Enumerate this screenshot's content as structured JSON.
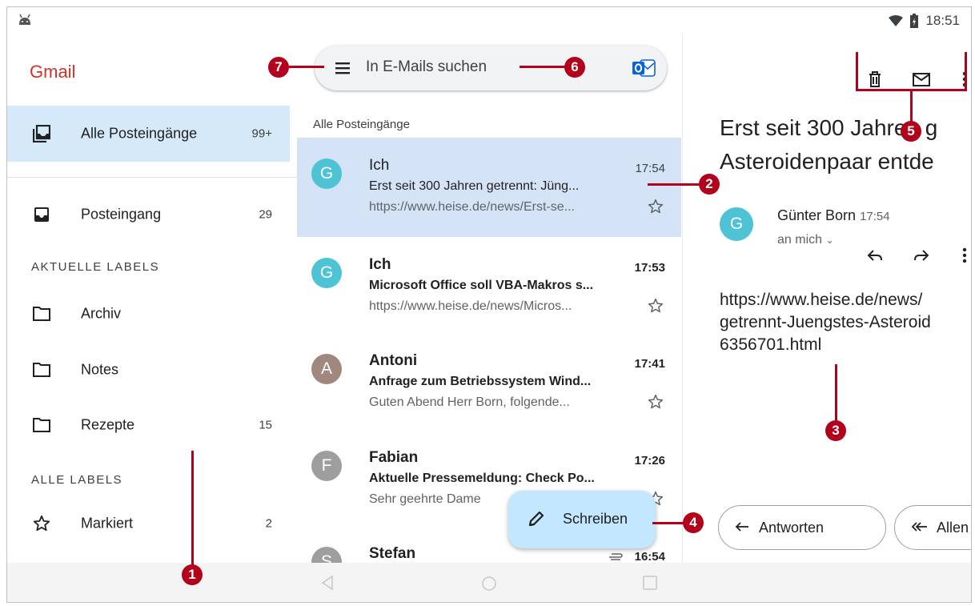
{
  "statusbar": {
    "time": "18:51"
  },
  "sidebar": {
    "app_name": "Gmail",
    "items": [
      {
        "label": "Alle Posteingänge",
        "count": "99+"
      },
      {
        "label": "Posteingang",
        "count": "29"
      },
      {
        "label": "Archiv",
        "count": ""
      },
      {
        "label": "Notes",
        "count": ""
      },
      {
        "label": "Rezepte",
        "count": "15"
      },
      {
        "label": "Markiert",
        "count": "2"
      }
    ],
    "section_recent": "AKTUELLE LABELS",
    "section_all": "ALLE LABELS"
  },
  "search": {
    "placeholder": "In E-Mails suchen"
  },
  "list": {
    "header": "Alle Posteingänge",
    "mails": [
      {
        "initial": "G",
        "color": "#4ec3d6",
        "sender": "Ich",
        "time": "17:54",
        "subject": "Erst seit 300 Jahren getrennt: Jüng...",
        "snippet": "https://www.heise.de/news/Erst-se..."
      },
      {
        "initial": "G",
        "color": "#4ec3d6",
        "sender": "Ich",
        "time": "17:53",
        "subject": "Microsoft Office soll VBA-Makros s...",
        "snippet": "https://www.heise.de/news/Micros..."
      },
      {
        "initial": "A",
        "color": "#a1887f",
        "sender": "Antoni",
        "time": "17:41",
        "subject": "Anfrage zum Betriebssystem Wind...",
        "snippet": "Guten Abend Herr Born, folgende..."
      },
      {
        "initial": "F",
        "color": "#9e9e9e",
        "sender": "Fabian",
        "time": "17:26",
        "subject": "Aktuelle Pressemeldung: Check Po...",
        "snippet": "Sehr geehrte Dame"
      },
      {
        "initial": "S",
        "color": "#9e9e9e",
        "sender": "Stefan",
        "time": "16:54",
        "subject": "",
        "snippet": ""
      }
    ]
  },
  "compose": {
    "label": "Schreiben"
  },
  "reader": {
    "title_line1": "Erst seit 300 Jahren g",
    "title_line2": "Asteroidenpaar entde",
    "from": "Günter Born",
    "from_time": "17:54",
    "to": "an mich",
    "body_line1": "https://www.heise.de/news/",
    "body_line2": "getrennt-Juengstes-Asteroid",
    "body_line3": "6356701.html",
    "reply_label": "Antworten",
    "reply_all_label": "Allen a"
  },
  "callouts": [
    "1",
    "2",
    "3",
    "4",
    "5",
    "6",
    "7"
  ]
}
